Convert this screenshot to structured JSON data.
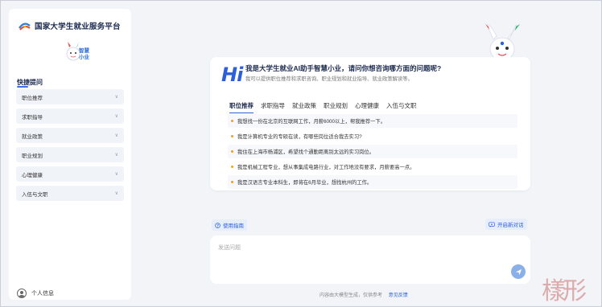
{
  "app": {
    "title": "国家大学生就业服务平台"
  },
  "sidebar": {
    "mascot_text": [
      "智慧",
      "小业"
    ],
    "quick_title": "快捷提问",
    "items": [
      {
        "label": "职位推荐"
      },
      {
        "label": "求职指导"
      },
      {
        "label": "就业政策"
      },
      {
        "label": "职业规划"
      },
      {
        "label": "心理健康"
      },
      {
        "label": "入伍与文职"
      }
    ],
    "profile_label": "个人信息"
  },
  "card": {
    "hi": "Hi",
    "greeting": "我是大学生就业AI助手智慧小业，请问你想咨询哪方面的问题呢?",
    "subtitle": "我可以提供职位推荐和求职咨询、职业规划和就业指导、就业政策解读等。",
    "tabs": [
      {
        "label": "职位推荐",
        "active": true
      },
      {
        "label": "求职指导",
        "active": false
      },
      {
        "label": "就业政策",
        "active": false
      },
      {
        "label": "职业规划",
        "active": false
      },
      {
        "label": "心理健康",
        "active": false
      },
      {
        "label": "入伍与文职",
        "active": false
      }
    ],
    "questions": [
      "我想找一份在北京的互联网工作，月薪6000以上，帮我推荐一下。",
      "我是计算机专业的专硕在读，有哪些岗位适合我去实习?",
      "我住在上海市杨浦区，希望找个通勤距离别太远的实习岗位。",
      "我是机械工程专业，想从事集成电路行业，对工作地没有要求，月薪要高一点。",
      "我是汉语言专业本科生，即将在6月毕业，想找杭州的工作。"
    ]
  },
  "footer": {
    "guide_label": "使用指南",
    "newchat_label": "开启新对话",
    "input_placeholder": "发送问题",
    "disclaimer": "内容由大模型生成，仅供参考",
    "feedback": "意见反馈"
  },
  "colors": {
    "accent": "#2c5fd8",
    "bullet": "#f0a020"
  },
  "icons": {
    "brand": "national-emblem-logo",
    "guide": "question-circle-icon",
    "newchat": "new-chat-icon",
    "send": "send-icon",
    "profile": "user-circle-icon",
    "chevron": "chevron-down-icon"
  }
}
